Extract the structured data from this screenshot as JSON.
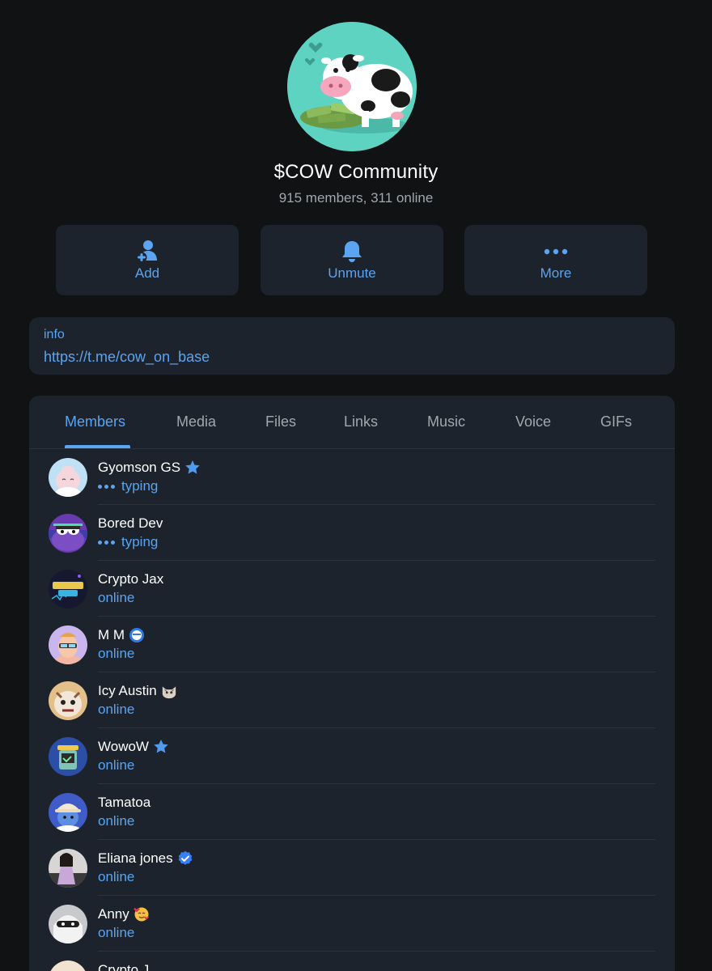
{
  "group": {
    "title": "$COW Community",
    "subtitle": "915 members, 311 online"
  },
  "actions": [
    {
      "label": "Add",
      "icon": "add-user-icon"
    },
    {
      "label": "Unmute",
      "icon": "bell-icon"
    },
    {
      "label": "More",
      "icon": "more-dots-icon"
    }
  ],
  "info": {
    "label": "info",
    "link": "https://t.me/cow_on_base"
  },
  "tabs": [
    "Members",
    "Media",
    "Files",
    "Links",
    "Music",
    "Voice",
    "GIFs"
  ],
  "active_tab": "Members",
  "members": [
    {
      "name": "Gyomson GS",
      "status": "typing",
      "badge": "star-icon"
    },
    {
      "name": "Bored Dev",
      "status": "typing",
      "badge": ""
    },
    {
      "name": "Crypto Jax",
      "status": "online",
      "badge": ""
    },
    {
      "name": "M M",
      "status": "online",
      "badge": "emoji-badge-icon"
    },
    {
      "name": "Icy Austin",
      "status": "online",
      "badge": "cat-emoji-icon"
    },
    {
      "name": "WowoW",
      "status": "online",
      "badge": "star-icon"
    },
    {
      "name": "Tamatoa",
      "status": "online",
      "badge": ""
    },
    {
      "name": "Eliana jones",
      "status": "online",
      "badge": "verified-icon"
    },
    {
      "name": "Anny",
      "status": "online",
      "badge": "hearts-face-emoji-icon"
    },
    {
      "name": "Crypto J",
      "status": "",
      "badge": ""
    }
  ],
  "colors": {
    "background": "#101214",
    "card": "#1c232c",
    "accent": "#5ba4f1",
    "muted": "#a0a7ae"
  }
}
